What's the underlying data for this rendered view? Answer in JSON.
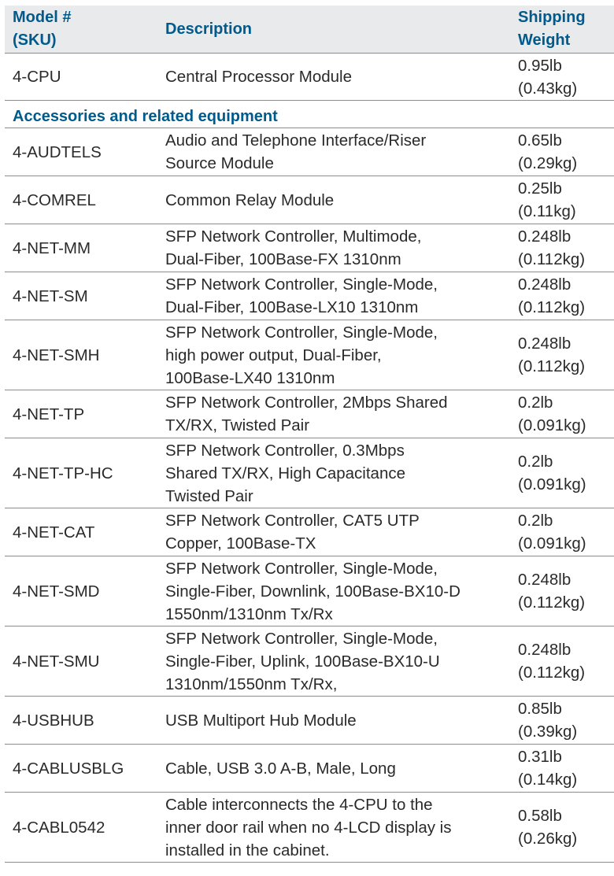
{
  "header": {
    "model": "Model #\n(SKU)",
    "model_line1": "Model #",
    "model_line2": "(SKU)",
    "description": "Description",
    "weight_line1": "Shipping",
    "weight_line2": "Weight"
  },
  "main_rows": [
    {
      "sku": "4-CPU",
      "description": "Central Processor Module",
      "weight_lb": "0.95lb",
      "weight_kg": "(0.43kg)"
    }
  ],
  "section_title": "Accessories and related equipment",
  "rows": [
    {
      "sku": "4-AUDTELS",
      "description_lines": [
        "Audio and Telephone Interface/Riser",
        "Source Module"
      ],
      "weight_lb": "0.65lb",
      "weight_kg": "(0.29kg)"
    },
    {
      "sku": "4-COMREL",
      "description_lines": [
        "Common Relay Module"
      ],
      "weight_lb": "0.25lb",
      "weight_kg": "(0.11kg)"
    },
    {
      "sku": "4-NET-MM",
      "description_lines": [
        "SFP Network Controller, Multimode,",
        "Dual-Fiber, 100Base-FX 1310nm"
      ],
      "weight_lb": "0.248lb",
      "weight_kg": "(0.112kg)"
    },
    {
      "sku": "4-NET-SM",
      "description_lines": [
        "SFP Network Controller, Single-Mode,",
        "Dual-Fiber, 100Base-LX10 1310nm"
      ],
      "weight_lb": "0.248lb",
      "weight_kg": "(0.112kg)"
    },
    {
      "sku": "4-NET-SMH",
      "description_lines": [
        "SFP Network Controller, Single-Mode,",
        "high power output, Dual-Fiber,",
        "100Base-LX40 1310nm"
      ],
      "weight_lb": "0.248lb",
      "weight_kg": "(0.112kg)"
    },
    {
      "sku": "4-NET-TP",
      "description_lines": [
        "SFP Network Controller, 2Mbps Shared",
        "TX/RX, Twisted Pair"
      ],
      "weight_lb": "0.2lb",
      "weight_kg": "(0.091kg)"
    },
    {
      "sku": "4-NET-TP-HC",
      "description_lines": [
        "SFP Network Controller, 0.3Mbps",
        "Shared TX/RX, High Capacitance",
        "Twisted Pair"
      ],
      "weight_lb": "0.2lb",
      "weight_kg": "(0.091kg)"
    },
    {
      "sku": "4-NET-CAT",
      "description_lines": [
        "SFP Network Controller, CAT5 UTP",
        "Copper, 100Base-TX"
      ],
      "weight_lb": "0.2lb",
      "weight_kg": "(0.091kg)"
    },
    {
      "sku": "4-NET-SMD",
      "description_lines": [
        "SFP Network Controller, Single-Mode,",
        "Single-Fiber, Downlink, 100Base-BX10-D",
        "1550nm/1310nm Tx/Rx"
      ],
      "weight_lb": "0.248lb",
      "weight_kg": "(0.112kg)"
    },
    {
      "sku": "4-NET-SMU",
      "description_lines": [
        "SFP Network Controller, Single-Mode,",
        "Single-Fiber, Uplink, 100Base-BX10-U",
        "1310nm/1550nm Tx/Rx,"
      ],
      "weight_lb": "0.248lb",
      "weight_kg": "(0.112kg)"
    },
    {
      "sku": "4-USBHUB",
      "description_lines": [
        "USB Multiport Hub Module"
      ],
      "weight_lb": "0.85lb",
      "weight_kg": "(0.39kg)"
    },
    {
      "sku": "4-CABLUSBLG",
      "description_lines": [
        "Cable, USB 3.0 A-B, Male, Long"
      ],
      "weight_lb": "0.31lb",
      "weight_kg": "(0.14kg)"
    },
    {
      "sku": "4-CABL0542",
      "description_lines": [
        "Cable interconnects the 4-CPU to the",
        "inner door rail when no 4-LCD display is",
        "installed in the cabinet."
      ],
      "weight_lb": "0.58lb",
      "weight_kg": "(0.26kg)"
    }
  ]
}
